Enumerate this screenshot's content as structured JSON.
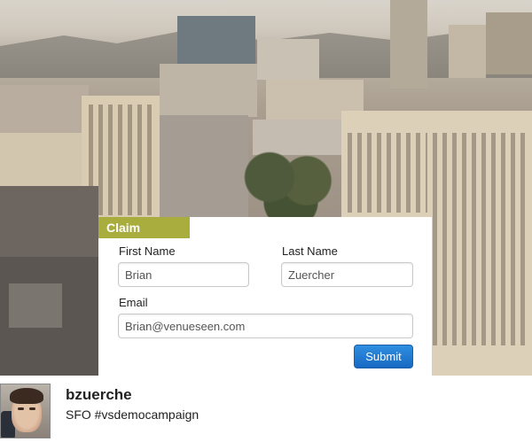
{
  "photo": {
    "icon": "cityscape-photo"
  },
  "claim": {
    "tab_label": "Claim",
    "first_name": {
      "label": "First Name",
      "value": "Brian"
    },
    "last_name": {
      "label": "Last Name",
      "value": "Zuercher"
    },
    "email": {
      "label": "Email",
      "value": "Brian@venueseen.com"
    },
    "submit_label": "Submit",
    "tab_color": "#a8ad3d",
    "button_color": "#1769c2"
  },
  "post": {
    "username": "bzuerche",
    "caption": "SFO #vsdemocampaign",
    "avatar_icon": "user-avatar"
  }
}
